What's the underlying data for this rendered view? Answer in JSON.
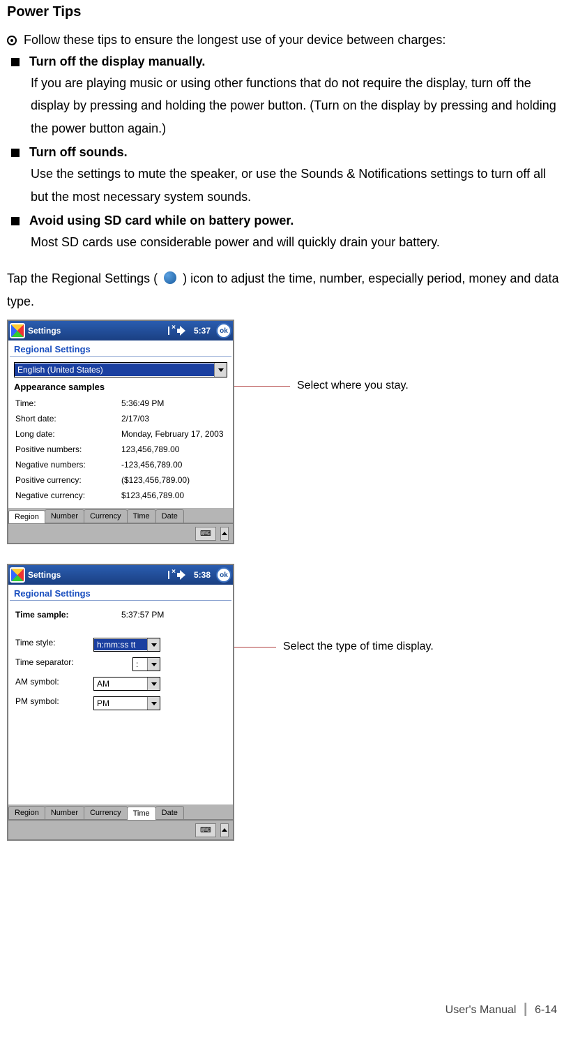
{
  "heading": "Power Tips",
  "intro": "Follow these tips to ensure the longest use of your device between charges:",
  "tips": [
    {
      "title": "Turn off the display manually.",
      "body": "If you are playing music or using other functions that do not require the display, turn off the display by pressing and holding the power button. (Turn on the display by pressing and holding the power button again.)"
    },
    {
      "title": "Turn off sounds.",
      "body": "Use the settings to mute the speaker, or use the Sounds & Notifications settings to turn off all but the most necessary system sounds."
    },
    {
      "title": "Avoid using SD card while on battery power.",
      "body": "Most SD cards use considerable power and will quickly drain your battery."
    }
  ],
  "regional_intro_1": "Tap the Regional Settings (",
  "regional_intro_2": ") icon to adjust the time, number, especially period, money and data type.",
  "screenshot1": {
    "topbar": {
      "title": "Settings",
      "time": "5:37",
      "ok": "ok"
    },
    "section_title": "Regional Settings",
    "locale_selected": "English (United States)",
    "appearance_label": "Appearance samples",
    "rows": [
      {
        "k": "Time:",
        "v": "5:36:49 PM"
      },
      {
        "k": "Short date:",
        "v": "2/17/03"
      },
      {
        "k": "Long date:",
        "v": "Monday, February 17, 2003"
      },
      {
        "k": "Positive numbers:",
        "v": "123,456,789.00"
      },
      {
        "k": "Negative numbers:",
        "v": "-123,456,789.00"
      },
      {
        "k": "Positive currency:",
        "v": "($123,456,789.00)"
      },
      {
        "k": "Negative currency:",
        "v": "$123,456,789.00"
      }
    ],
    "tabs": [
      "Region",
      "Number",
      "Currency",
      "Time",
      "Date"
    ],
    "active_tab": 0,
    "callout": "Select where you stay."
  },
  "screenshot2": {
    "topbar": {
      "title": "Settings",
      "time": "5:38",
      "ok": "ok"
    },
    "section_title": "Regional Settings",
    "time_sample_label": "Time sample:",
    "time_sample_value": "5:37:57 PM",
    "fields": [
      {
        "k": "Time style:",
        "v": "h:mm:ss tt",
        "highlight": true,
        "mini": false
      },
      {
        "k": "Time separator:",
        "v": ":",
        "highlight": false,
        "mini": true
      },
      {
        "k": "AM symbol:",
        "v": "AM",
        "highlight": false,
        "mini": false
      },
      {
        "k": "PM symbol:",
        "v": "PM",
        "highlight": false,
        "mini": false
      }
    ],
    "tabs": [
      "Region",
      "Number",
      "Currency",
      "Time",
      "Date"
    ],
    "active_tab": 3,
    "callout": "Select the type of time display."
  },
  "footer": {
    "left": "User's Manual",
    "right": "6-14"
  }
}
